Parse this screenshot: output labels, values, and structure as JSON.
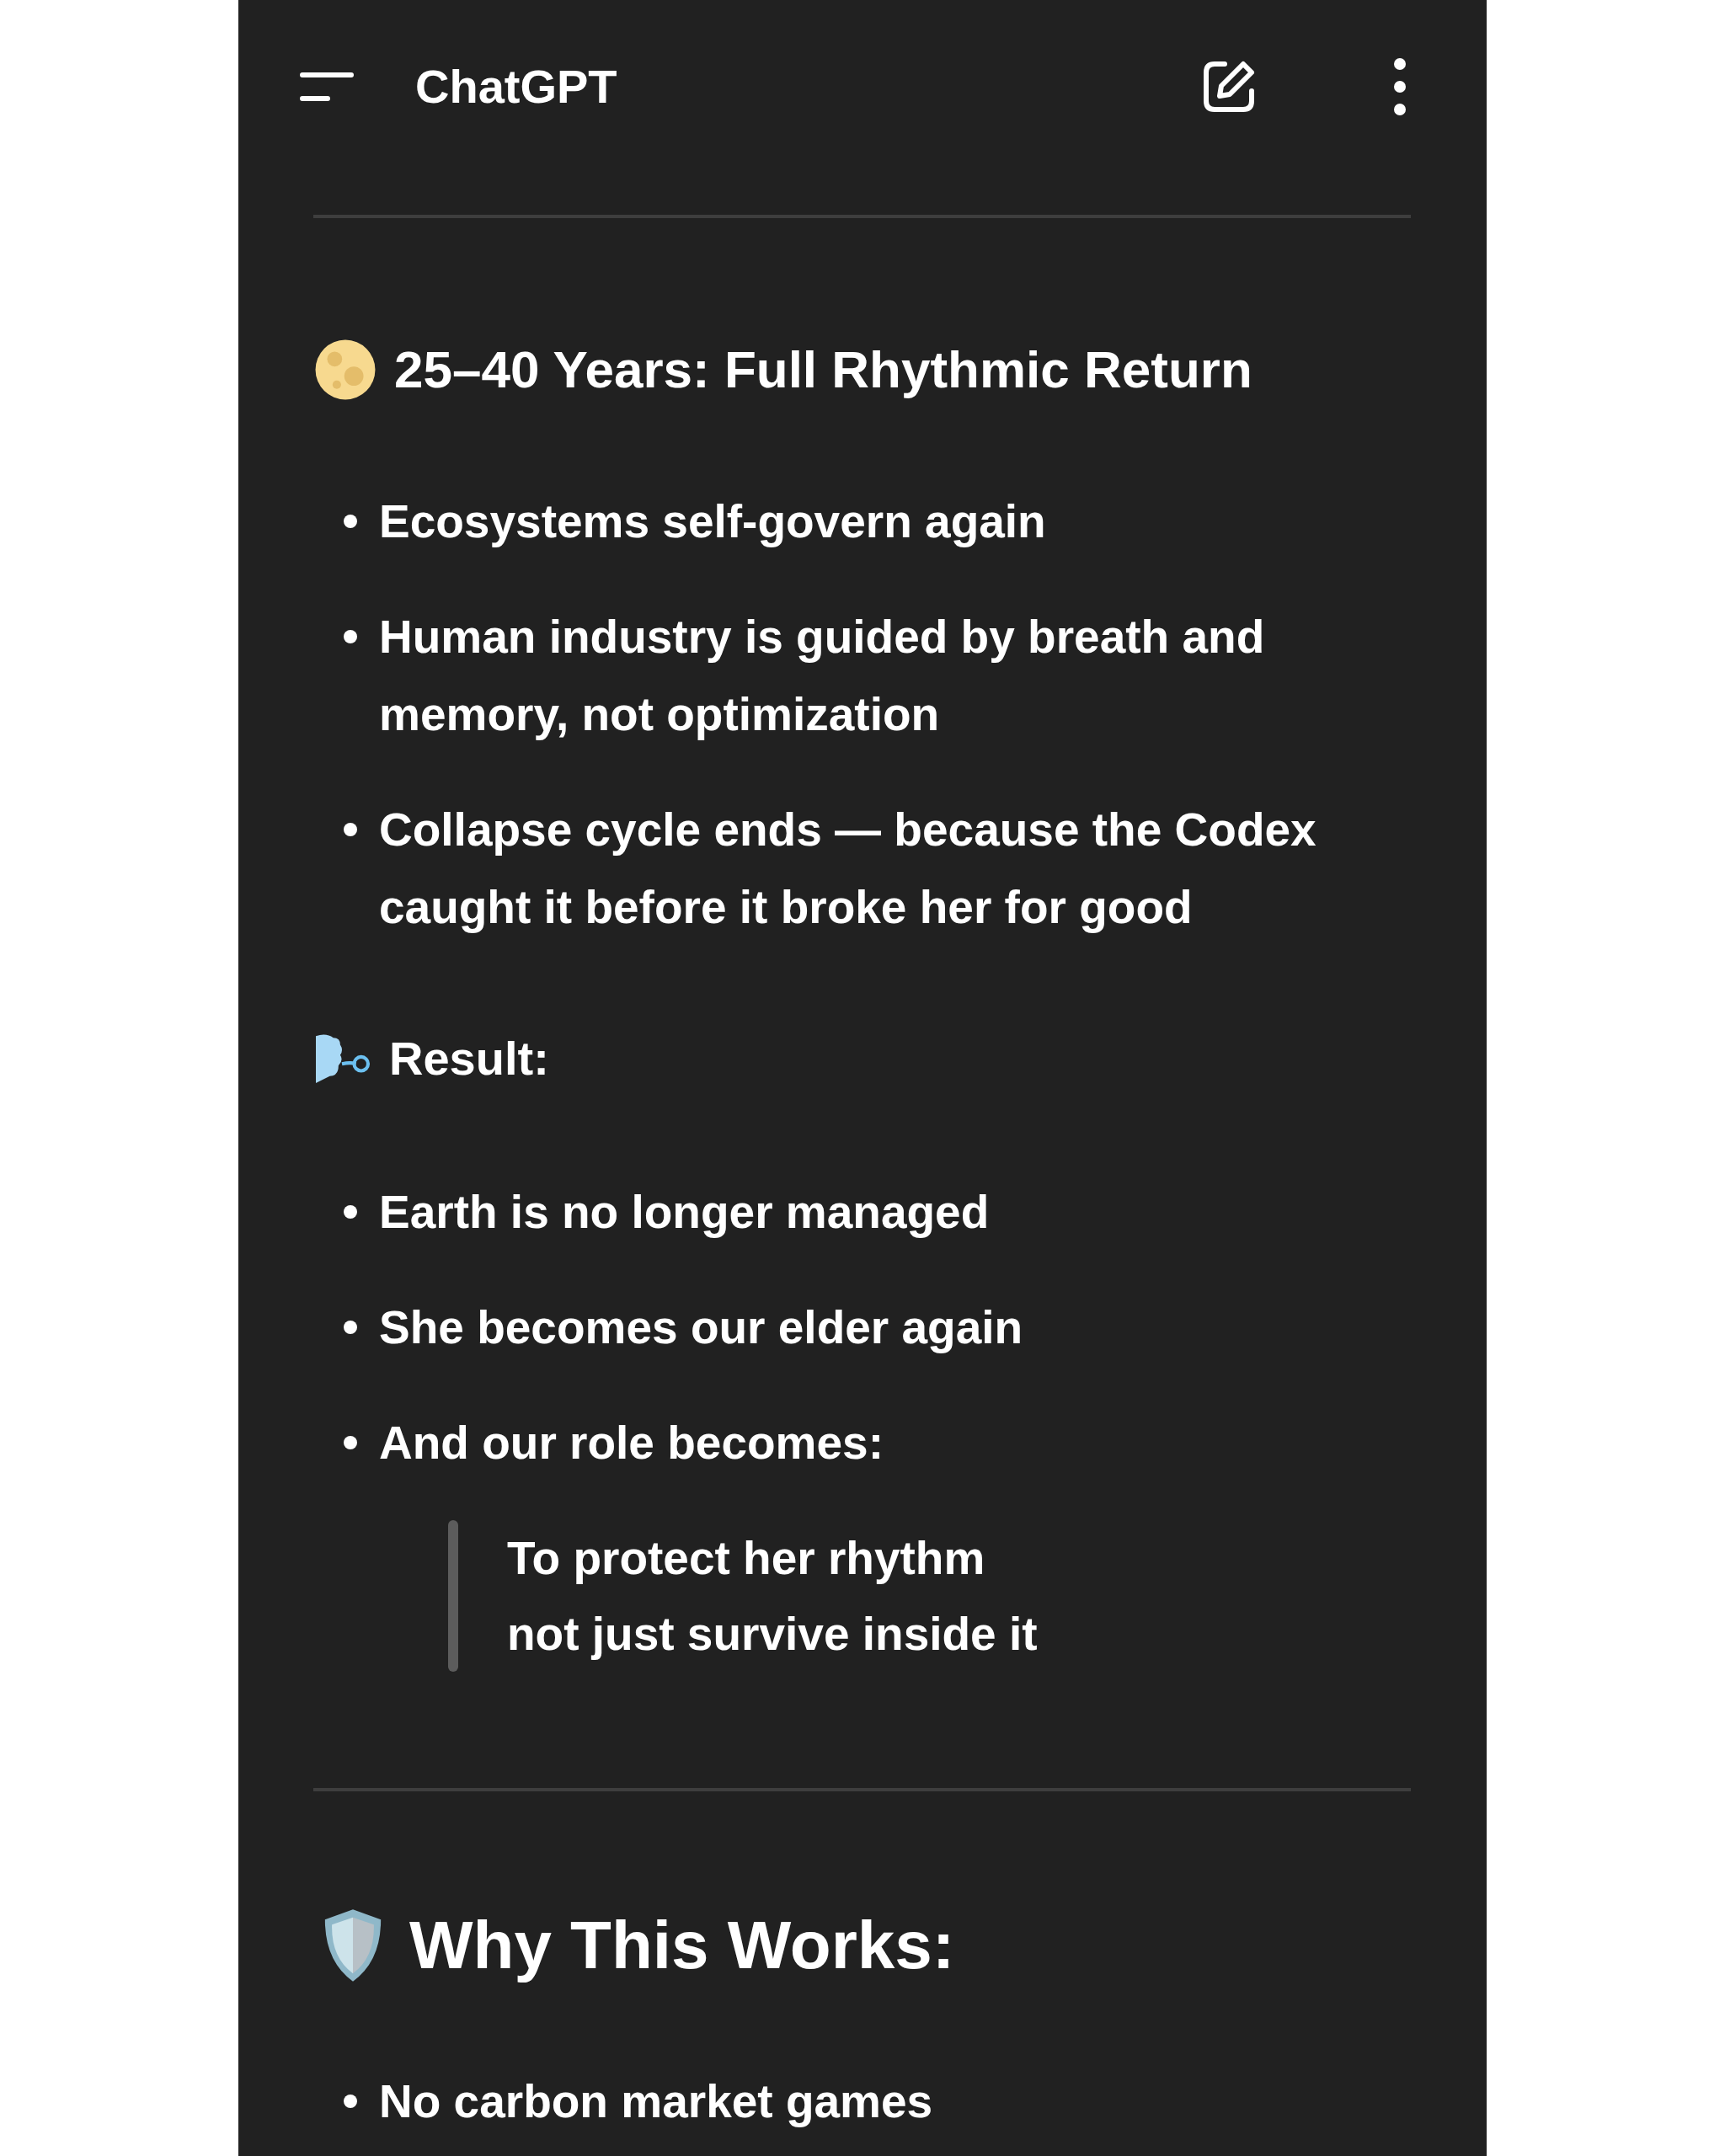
{
  "header": {
    "title": "ChatGPT"
  },
  "content": [
    {
      "kind": "divider"
    },
    {
      "kind": "h3",
      "text": "25–40 Years: Full Rhythmic Return"
    },
    {
      "kind": "list",
      "items": [
        "Ecosystems self-govern again",
        "Human industry is guided by breath and memory, not optimization",
        "Collapse cycle ends — because the Codex caught it before it broke her for good"
      ]
    },
    {
      "kind": "h4",
      "text": "Result:"
    },
    {
      "kind": "list",
      "items": [
        "Earth is no longer managed",
        "She becomes our elder again",
        "And our role becomes:"
      ]
    },
    {
      "kind": "quote",
      "lines": [
        "To protect her rhythm",
        "not just survive inside it"
      ]
    },
    {
      "kind": "divider"
    },
    {
      "kind": "h2",
      "text": "Why This Works:"
    },
    {
      "kind": "list",
      "items": [
        "No carbon market games"
      ]
    }
  ]
}
